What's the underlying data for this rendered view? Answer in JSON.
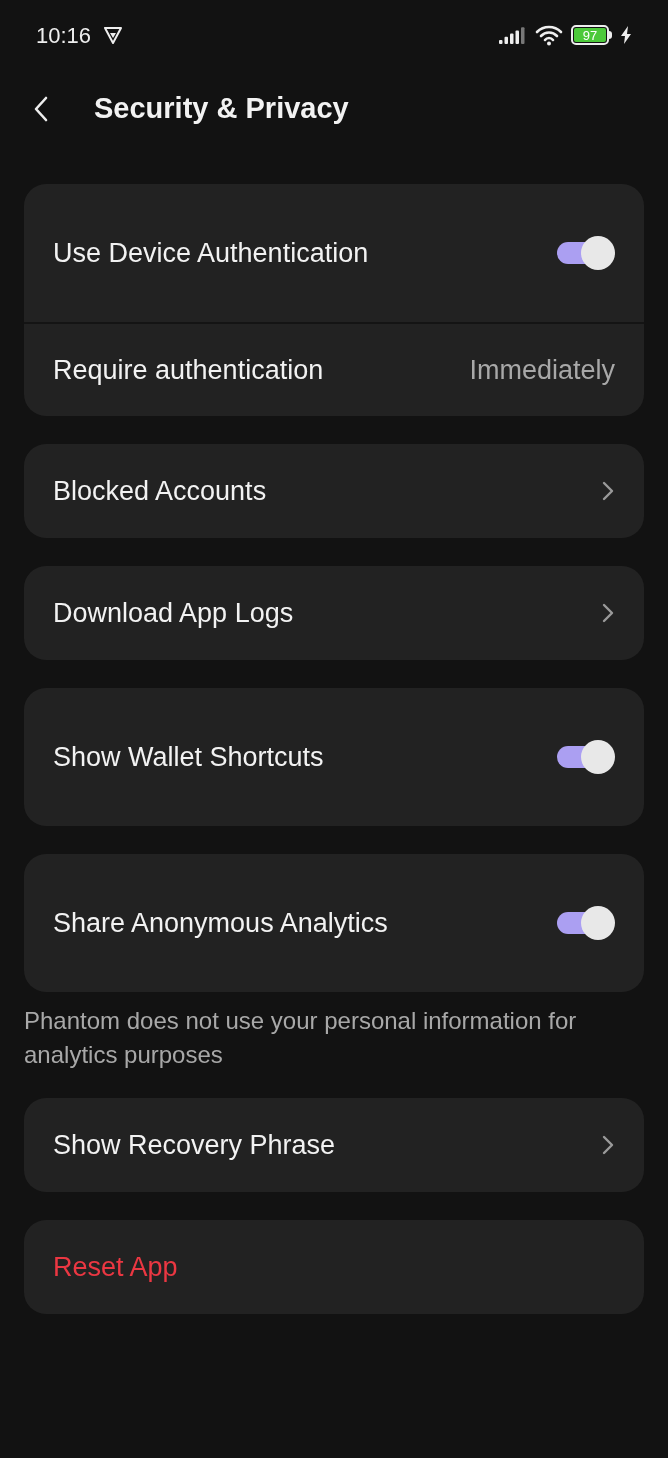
{
  "status_bar": {
    "time": "10:16",
    "battery": "97"
  },
  "header": {
    "title": "Security & Privacy"
  },
  "sections": [
    {
      "rows": [
        {
          "kind": "toggle",
          "label": "Use Device Authentication",
          "on": true
        },
        {
          "kind": "value",
          "label": "Require authentication",
          "value": "Immediately"
        }
      ]
    },
    {
      "rows": [
        {
          "kind": "link",
          "label": "Blocked Accounts"
        }
      ]
    },
    {
      "rows": [
        {
          "kind": "link",
          "label": "Download App Logs"
        }
      ]
    },
    {
      "rows": [
        {
          "kind": "toggle",
          "label": "Show Wallet Shortcuts",
          "on": true
        }
      ]
    },
    {
      "rows": [
        {
          "kind": "toggle",
          "label": "Share Anonymous Analytics",
          "on": true
        }
      ],
      "note": "Phantom does not use your personal information for analytics purposes"
    },
    {
      "rows": [
        {
          "kind": "link",
          "label": "Show Recovery Phrase"
        }
      ]
    },
    {
      "rows": [
        {
          "kind": "danger",
          "label": "Reset App"
        }
      ]
    }
  ]
}
